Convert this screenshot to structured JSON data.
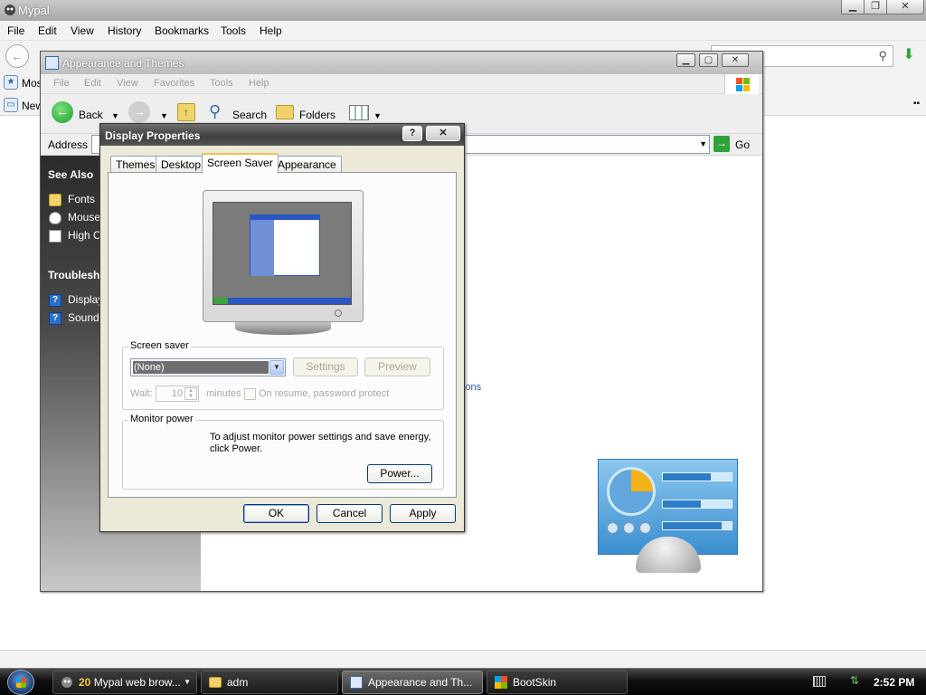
{
  "browser": {
    "title": "Mypal",
    "menu": [
      "File",
      "Edit",
      "View",
      "History",
      "Bookmarks",
      "Tools",
      "Help"
    ],
    "bookmark_label": "Mos",
    "tab_label": "New"
  },
  "explorer": {
    "title": "Appearance and Themes",
    "menu": [
      "File",
      "Edit",
      "View",
      "Favorites",
      "Tools",
      "Help"
    ],
    "toolbar": {
      "back": "Back",
      "search": "Search",
      "folders": "Folders"
    },
    "address_label": "Address",
    "go_label": "Go",
    "see_also": {
      "heading": "See Also",
      "items": [
        "Fonts",
        "Mouse",
        "High C"
      ]
    },
    "troubleshooters": {
      "heading": "Troublesho",
      "items": [
        "Display",
        "Sound"
      ]
    },
    "partial_link": "ions"
  },
  "dialog": {
    "title": "Display Properties",
    "help_btn": "?",
    "close_btn": "✕",
    "tabs": [
      "Themes",
      "Desktop",
      "Screen Saver",
      "Appearance"
    ],
    "active_tab": "Screen Saver",
    "screensaver": {
      "group_label": "Screen saver",
      "selected": "(None)",
      "settings_btn": "Settings",
      "preview_btn": "Preview",
      "wait_label": "Wait:",
      "wait_value": "10",
      "minutes_label": "minutes",
      "resume_label": "On resume, password protect"
    },
    "monitor_power": {
      "group_label": "Monitor power",
      "text": "To adjust monitor power settings and save energy, click Power.",
      "power_btn": "Power..."
    },
    "buttons": {
      "ok": "OK",
      "cancel": "Cancel",
      "apply": "Apply"
    }
  },
  "taskbar": {
    "items": [
      {
        "count": "20",
        "label": "Mypal web brow..."
      },
      {
        "label": "adm"
      },
      {
        "label": "Appearance and Th..."
      },
      {
        "label": "BootSkin"
      }
    ],
    "clock": "2:52 PM"
  },
  "colors": {
    "explorer_sidebar_top": "#2b2b2b",
    "dialog_face": "#ece9d8",
    "taskbar": "#0f0f0f",
    "tab_highlight": "#f3c24a"
  }
}
